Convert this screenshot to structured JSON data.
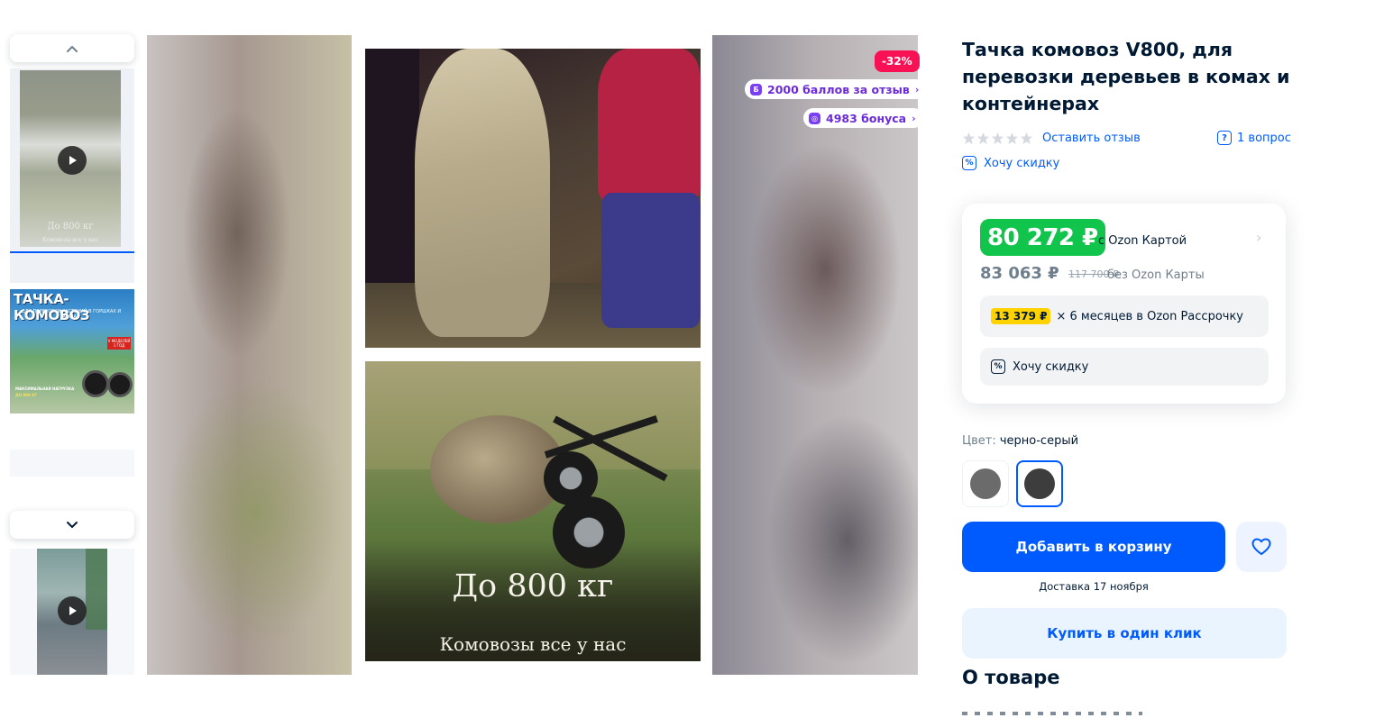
{
  "product": {
    "title": "Тачка комовоз V800, для перевозки деревьев в комах и контейнерах",
    "review_link": "Оставить отзыв",
    "questions_link": "1 вопрос",
    "want_discount": "Хочу скидку",
    "rating_stars": 0
  },
  "gallery": {
    "discount_badge": "-32%",
    "reviews_bonus": "2000 баллов за отзыв",
    "bonus": "4983 бонуса",
    "bonus_icon_letter": "Б",
    "caption_big": "До 800 кг",
    "caption_small": "Комовозы все у нас"
  },
  "thumbnails": {
    "t1_caption": "До 800 кг",
    "t1_caption_small": "Комовозы все у нас",
    "t2_title": "ТАЧКА-КОМОВОЗ",
    "t2_subtitle": "ДЛЯ ПЕРЕВОЗКИ РАСТЕНИЙ В ГОРШКАХ И КОМАХ",
    "t2_tag": "V МОДЕЛЕЙ 1 ГОД",
    "t2_footer": "МАКСИМАЛЬНАЯ НАГРУЗКА",
    "t2_footer2": "ДО 800 КГ"
  },
  "pricing": {
    "ozon_card_price": "80 272 ₽",
    "ozon_card_label": "с Ozon Картой",
    "regular_price": "83 063 ₽",
    "original_price": "117 700 ₽",
    "regular_label": "без Ozon Карты",
    "installment_price": "13 379 ₽",
    "installment_text": "× 6 месяцев в Ozon Рассрочку",
    "want_discount": "Хочу скидку"
  },
  "color": {
    "label": "Цвет:",
    "value": "черно-серый",
    "options": [
      "#6b6b6b",
      "#3d3d3d"
    ],
    "selected_index": 1
  },
  "actions": {
    "add_to_cart": "Добавить в корзину",
    "delivery": "Доставка 17 ноября",
    "buy_one_click": "Купить в один клик"
  },
  "about": {
    "heading": "О товаре"
  },
  "colors": {
    "accent": "#005bff",
    "price_green": "#10c44c",
    "discount_red": "#f91155",
    "bonus_purple": "#7b3ff2",
    "installment_yellow": "#ffd200"
  }
}
